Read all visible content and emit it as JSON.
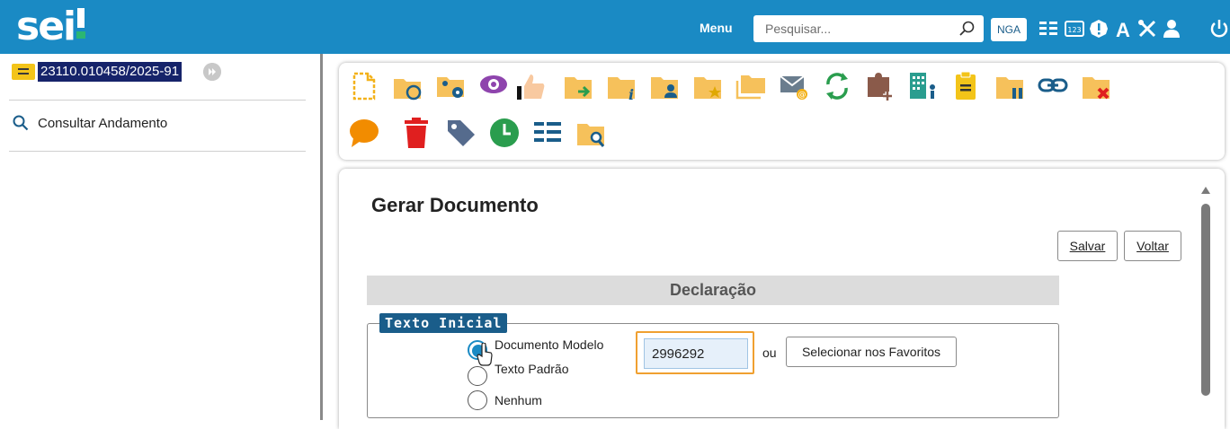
{
  "header": {
    "logo_text": "sei",
    "menu_label": "Menu",
    "search": {
      "placeholder": "Pesquisar...",
      "value": ""
    },
    "unit_badge": "NGA",
    "icons": [
      "search-icon",
      "list-icon",
      "calculator-icon",
      "alert-icon",
      "font-icon",
      "tools-icon",
      "user-icon",
      "power-icon"
    ],
    "brand_color": "#1a8ac4"
  },
  "sidebar": {
    "process_number": "23110.010458/2025-91",
    "links": [
      {
        "label": "Consultar Andamento",
        "icon": "search-icon"
      }
    ]
  },
  "toolbar": {
    "icons": [
      "new-document-icon",
      "folder-sync-icon",
      "folder-users-settings-icon",
      "eye-icon",
      "thumbs-up-icon",
      "folder-send-icon",
      "folder-info-icon",
      "folder-user-icon",
      "folder-star-icon",
      "folders-icon",
      "email-icon",
      "refresh-icon",
      "puzzle-add-icon",
      "building-user-icon",
      "clipboard-icon",
      "folder-pause-icon",
      "link-icon",
      "folder-cancel-icon",
      "comment-icon",
      "trash-icon",
      "tag-icon",
      "clock-icon",
      "list-icon",
      "folder-search-icon"
    ]
  },
  "main": {
    "title": "Gerar Documento",
    "save_label": "Salvar",
    "back_label": "Voltar",
    "section_title": "Declaração",
    "fieldset_legend": "Texto Inicial",
    "radio_options": [
      "Documento Modelo",
      "Texto Padrão",
      "Nenhum"
    ],
    "selected_option": "Documento Modelo",
    "model_value": "2996292",
    "or_label": "ou",
    "favorites_label": "Selecionar nos Favoritos"
  }
}
